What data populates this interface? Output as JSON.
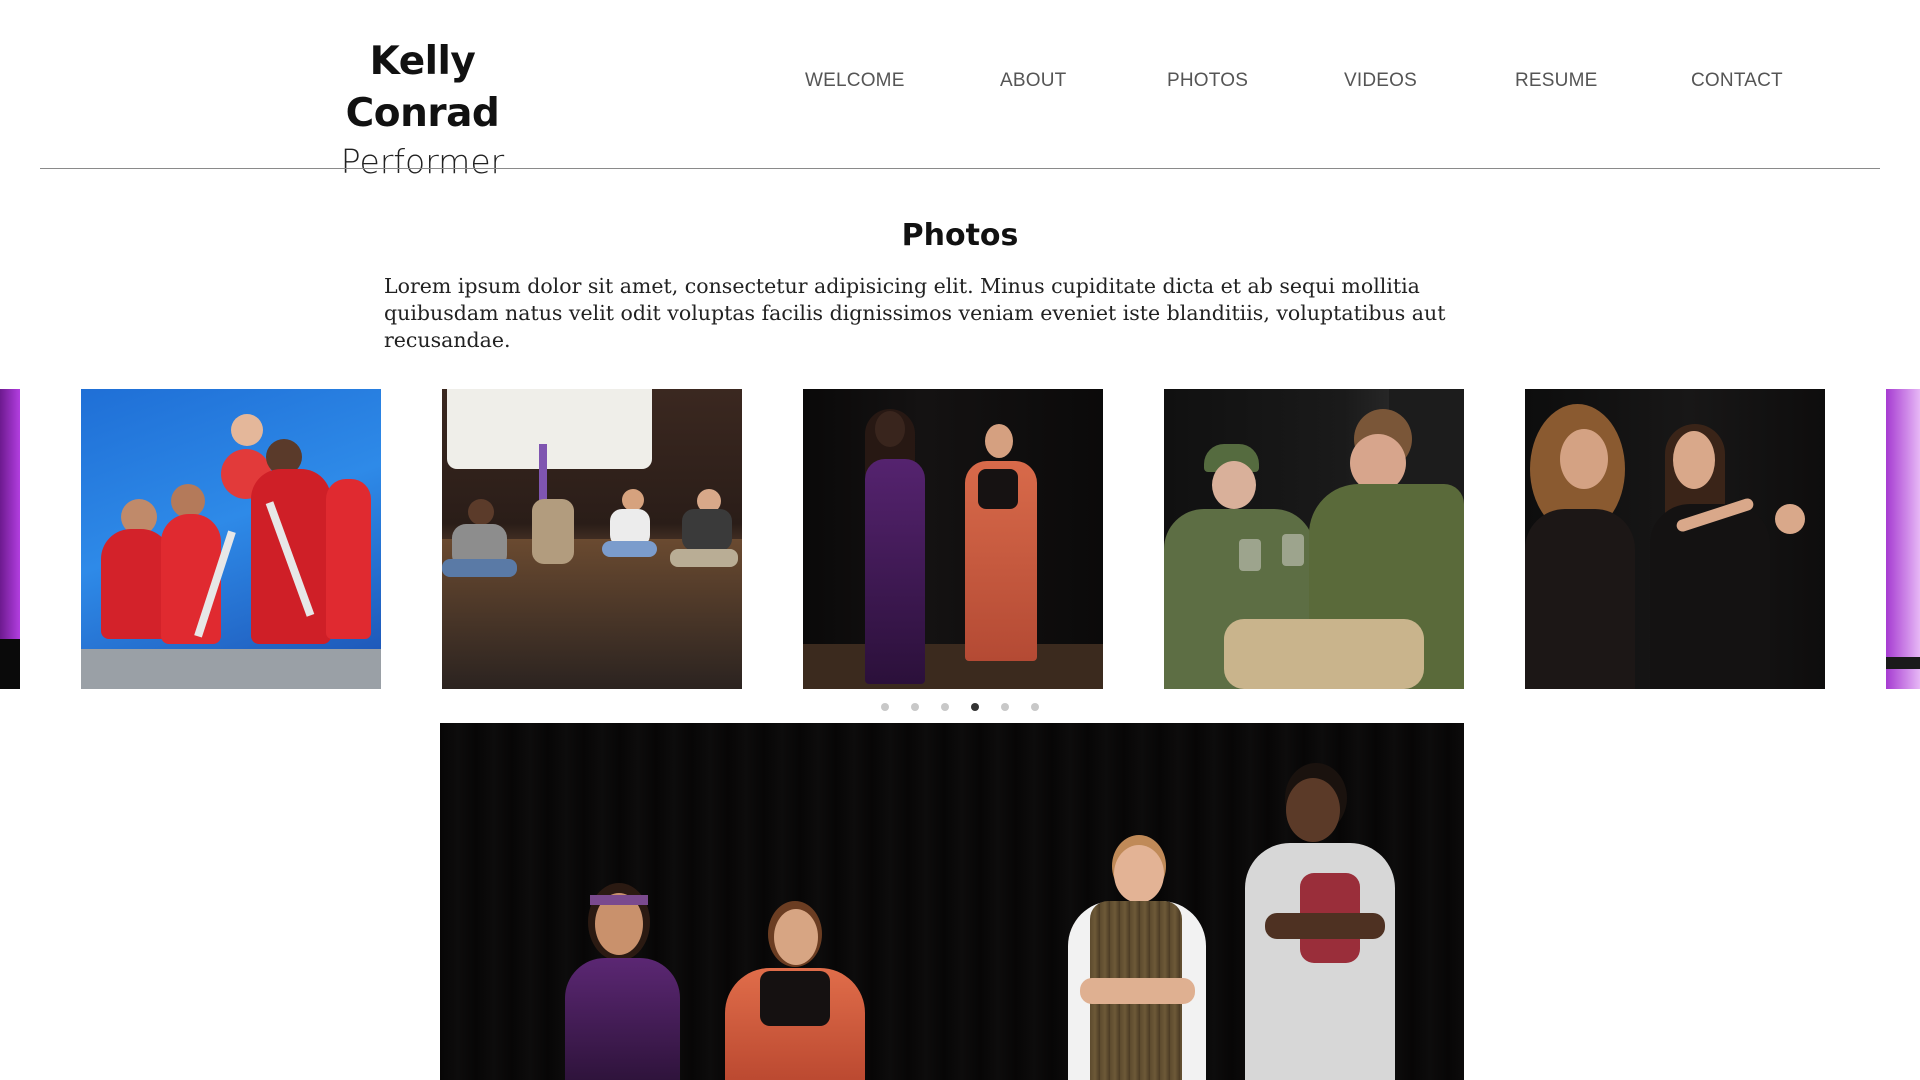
{
  "header": {
    "name": "Kelly Conrad",
    "subtitle": "Performer"
  },
  "nav": {
    "items": [
      "WELCOME",
      "ABOUT",
      "PHOTOS",
      "VIDEOS",
      "RESUME",
      "CONTACT"
    ]
  },
  "section": {
    "title": "Photos",
    "text": "Lorem ipsum dolor sit amet, consectetur adipisicing elit. Minus cupiditate dicta et ab sequi mollitia quibusdam natus velit odit voluptas facilis dignissimos veniam eveniet iste blanditiis, voluptatibus aut recusandae."
  },
  "carousel": {
    "slides": [
      {
        "subject": "ensemble-in-red-costumes"
      },
      {
        "subject": "actors-seated-on-stage"
      },
      {
        "subject": "two-actresses-in-period-dress"
      },
      {
        "subject": "soldiers-toasting"
      },
      {
        "subject": "two-actresses-gesturing"
      }
    ],
    "dots": 6,
    "active_dot_index": 3
  },
  "featured": {
    "subject": "four-actors-on-dark-stage"
  },
  "colors": {
    "nav_text": "#555555",
    "divider": "#8a8a8a",
    "dot_active": "#333333",
    "dot_inactive": "#c8c8c8",
    "peek_purple": "#9b2fc0"
  }
}
